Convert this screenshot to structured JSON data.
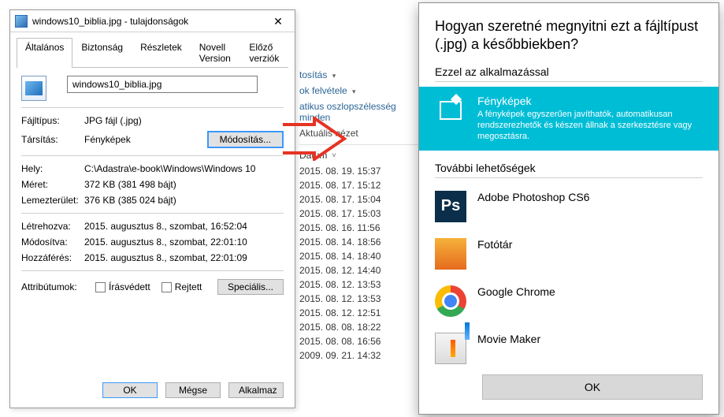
{
  "props": {
    "title": "windows10_biblia.jpg - tulajdonságok",
    "tabs": [
      "Általános",
      "Biztonság",
      "Részletek",
      "Novell Version",
      "Előző verziók"
    ],
    "filename": "windows10_biblia.jpg",
    "rows": {
      "filetype_k": "Fájltípus:",
      "filetype_v": "JPG fájl (.jpg)",
      "assoc_k": "Társítás:",
      "assoc_v": "Fényképek",
      "modify_btn": "Módosítás...",
      "loc_k": "Hely:",
      "loc_v": "C:\\Adastra\\e-book\\Windows\\Windows 10",
      "size_k": "Méret:",
      "size_v": "372 KB (381 498 bájt)",
      "disk_k": "Lemezterület:",
      "disk_v": "376 KB (385 024 bájt)",
      "created_k": "Létrehozva:",
      "created_v": "2015. augusztus 8., szombat, 16:52:04",
      "modified_k": "Módosítva:",
      "modified_v": "2015. augusztus 8., szombat, 22:01:10",
      "accessed_k": "Hozzáférés:",
      "accessed_v": "2015. augusztus 8., szombat, 22:01:09",
      "attr_k": "Attribútumok:",
      "readonly": "Írásvédett",
      "hidden": "Rejtett",
      "advanced": "Speciális..."
    },
    "footer": {
      "ok": "OK",
      "cancel": "Mégse",
      "apply": "Alkalmaz"
    }
  },
  "explorer": {
    "menu": {
      "sort": "tosítás",
      "colpick": "ok felvétele",
      "autosize": "atikus oszlopszélesség minden",
      "view": "Aktuális nézet"
    },
    "col": "Dátum",
    "dates": [
      "2015. 08. 19. 15:37",
      "2015. 08. 17. 15:12",
      "2015. 08. 17. 15:04",
      "2015. 08. 17. 15:03",
      "2015. 08. 16. 11:56",
      "2015. 08. 14. 18:56",
      "2015. 08. 14. 18:40",
      "2015. 08. 12. 14:40",
      "2015. 08. 12. 13:53",
      "2015. 08. 12. 13:53",
      "2015. 08. 12. 12:51",
      "2015. 08. 08. 18:22",
      "2015. 08. 08. 16:56",
      "2009. 09. 21. 14:32"
    ]
  },
  "openwith": {
    "title": "Hogyan szeretné megnyitni ezt a fájltípust (.jpg) a későbbiekben?",
    "keep": "Ezzel az alkalmazással",
    "selected": {
      "name": "Fényképek",
      "desc": "A fényképek egyszerűen javíthatók, automatikusan rendszerezhetők és készen állnak a szerkesztésre vagy megosztásra."
    },
    "other_hdr": "További lehetőségek",
    "others": [
      {
        "name": "Adobe Photoshop CS6",
        "icon": "ps"
      },
      {
        "name": "Fotótár",
        "icon": "gal"
      },
      {
        "name": "Google Chrome",
        "icon": "ch"
      },
      {
        "name": "Movie Maker",
        "icon": "mm"
      }
    ],
    "ok": "OK"
  }
}
